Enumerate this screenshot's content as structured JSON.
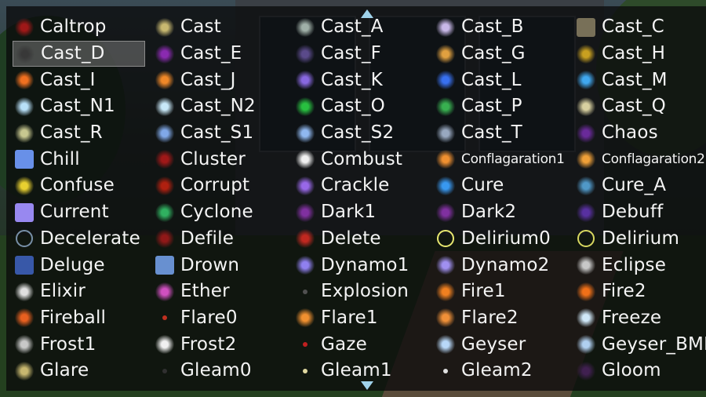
{
  "skills": [
    {
      "label": "Caltrop",
      "icon": "caltrop-icon",
      "color": "#a01818"
    },
    {
      "label": "Cast",
      "icon": "cast-icon",
      "color": "#c8b870"
    },
    {
      "label": "Cast_A",
      "icon": "cast-a-icon",
      "color": "#a0b0a8"
    },
    {
      "label": "Cast_B",
      "icon": "cast-b-icon",
      "color": "#c8b8e8"
    },
    {
      "label": "Cast_C",
      "icon": "cast-c-icon",
      "color": "#787058"
    },
    {
      "label": "Cast_D",
      "icon": "cast-d-icon",
      "color": "#383838"
    },
    {
      "label": "Cast_E",
      "icon": "cast-e-icon",
      "color": "#8a2ab0"
    },
    {
      "label": "Cast_F",
      "icon": "cast-f-icon",
      "color": "#5a4a8a"
    },
    {
      "label": "Cast_G",
      "icon": "cast-g-icon",
      "color": "#e0a040"
    },
    {
      "label": "Cast_H",
      "icon": "cast-h-icon",
      "color": "#c8a020"
    },
    {
      "label": "Cast_I",
      "icon": "cast-i-icon",
      "color": "#f07020"
    },
    {
      "label": "Cast_J",
      "icon": "cast-j-icon",
      "color": "#f08828"
    },
    {
      "label": "Cast_K",
      "icon": "cast-k-icon",
      "color": "#8868e0"
    },
    {
      "label": "Cast_L",
      "icon": "cast-l-icon",
      "color": "#3870f0"
    },
    {
      "label": "Cast_M",
      "icon": "cast-m-icon",
      "color": "#40a8f0"
    },
    {
      "label": "Cast_N1",
      "icon": "cast-n1-icon",
      "color": "#b8e0f8"
    },
    {
      "label": "Cast_N2",
      "icon": "cast-n2-icon",
      "color": "#c8e8f8"
    },
    {
      "label": "Cast_O",
      "icon": "cast-o-icon",
      "color": "#28c040"
    },
    {
      "label": "Cast_P",
      "icon": "cast-p-icon",
      "color": "#38b050"
    },
    {
      "label": "Cast_Q",
      "icon": "cast-q-icon",
      "color": "#d8d0a0"
    },
    {
      "label": "Cast_R",
      "icon": "cast-r-icon",
      "color": "#c8c890"
    },
    {
      "label": "Cast_S1",
      "icon": "cast-s1-icon",
      "color": "#80a8e8"
    },
    {
      "label": "Cast_S2",
      "icon": "cast-s2-icon",
      "color": "#90b8f0"
    },
    {
      "label": "Cast_T",
      "icon": "cast-t-icon",
      "color": "#98a8c0"
    },
    {
      "label": "Chaos",
      "icon": "chaos-icon",
      "color": "#6a2a9a"
    },
    {
      "label": "Chill",
      "icon": "chill-icon",
      "color": "#6890e8"
    },
    {
      "label": "Cluster",
      "icon": "cluster-icon",
      "color": "#a01818"
    },
    {
      "label": "Combust",
      "icon": "combust-icon",
      "color": "#f0f0f0"
    },
    {
      "label": "Conflagaration1",
      "icon": "conflagaration1-icon",
      "color": "#f09030"
    },
    {
      "label": "Conflagaration2",
      "icon": "conflagaration2-icon",
      "color": "#f0a038"
    },
    {
      "label": "Confuse",
      "icon": "confuse-icon",
      "color": "#e8d030"
    },
    {
      "label": "Corrupt",
      "icon": "corrupt-icon",
      "color": "#b02010"
    },
    {
      "label": "Crackle",
      "icon": "crackle-icon",
      "color": "#9868e8"
    },
    {
      "label": "Cure",
      "icon": "cure-icon",
      "color": "#3898f0"
    },
    {
      "label": "Cure_A",
      "icon": "cure-a-icon",
      "color": "#5098c8"
    },
    {
      "label": "Current",
      "icon": "current-icon",
      "color": "#9888f0"
    },
    {
      "label": "Cyclone",
      "icon": "cyclone-icon",
      "color": "#30b060"
    },
    {
      "label": "Dark1",
      "icon": "dark1-icon",
      "color": "#8030a0"
    },
    {
      "label": "Dark2",
      "icon": "dark2-icon",
      "color": "#8030a0"
    },
    {
      "label": "Debuff",
      "icon": "debuff-icon",
      "color": "#5830a0"
    },
    {
      "label": "Decelerate",
      "icon": "decelerate-icon",
      "color": "#7890a8"
    },
    {
      "label": "Defile",
      "icon": "defile-icon",
      "color": "#901818"
    },
    {
      "label": "Delete",
      "icon": "delete-icon",
      "color": "#c02820"
    },
    {
      "label": "Delirium0",
      "icon": "delirium0-icon",
      "color": "#e8e870"
    },
    {
      "label": "Delirium",
      "icon": "delirium-icon",
      "color": "#d8d860"
    },
    {
      "label": "Deluge",
      "icon": "deluge-icon",
      "color": "#3858a8"
    },
    {
      "label": "Drown",
      "icon": "drown-icon",
      "color": "#6890d0"
    },
    {
      "label": "Dynamo1",
      "icon": "dynamo1-icon",
      "color": "#9080f0"
    },
    {
      "label": "Dynamo2",
      "icon": "dynamo2-icon",
      "color": "#a090f0"
    },
    {
      "label": "Eclipse",
      "icon": "eclipse-icon",
      "color": "#c8c8c8"
    },
    {
      "label": "Elixir",
      "icon": "elixir-icon",
      "color": "#e0e0e0"
    },
    {
      "label": "Ether",
      "icon": "ether-icon",
      "color": "#d050c0"
    },
    {
      "label": "Explosion",
      "icon": "explosion-icon",
      "color": "#505050"
    },
    {
      "label": "Fire1",
      "icon": "fire1-icon",
      "color": "#f08020"
    },
    {
      "label": "Fire2",
      "icon": "fire2-icon",
      "color": "#f07018"
    },
    {
      "label": "Fireball",
      "icon": "fireball-icon",
      "color": "#e86020"
    },
    {
      "label": "Flare0",
      "icon": "flare0-icon",
      "color": "#c03020"
    },
    {
      "label": "Flare1",
      "icon": "flare1-icon",
      "color": "#f09030"
    },
    {
      "label": "Flare2",
      "icon": "flare2-icon",
      "color": "#f09038"
    },
    {
      "label": "Freeze",
      "icon": "freeze-icon",
      "color": "#d0e8f8"
    },
    {
      "label": "Frost1",
      "icon": "frost1-icon",
      "color": "#c8c8c8"
    },
    {
      "label": "Frost2",
      "icon": "frost2-icon",
      "color": "#f0f0f0"
    },
    {
      "label": "Gaze",
      "icon": "gaze-icon",
      "color": "#c02020"
    },
    {
      "label": "Geyser",
      "icon": "geyser-icon",
      "color": "#b8d8f8"
    },
    {
      "label": "Geyser_BMF",
      "icon": "geyser-bmf-icon",
      "color": "#b0d0f0"
    },
    {
      "label": "Glare",
      "icon": "glare-icon",
      "color": "#c8b870"
    },
    {
      "label": "Gleam0",
      "icon": "gleam0-icon",
      "color": "#303030"
    },
    {
      "label": "Gleam1",
      "icon": "gleam1-icon",
      "color": "#e0d8a0"
    },
    {
      "label": "Gleam2",
      "icon": "gleam2-icon",
      "color": "#e0e0e0"
    },
    {
      "label": "Gloom",
      "icon": "gloom-icon",
      "color": "#402050"
    }
  ],
  "selected_label": "Cast_D"
}
